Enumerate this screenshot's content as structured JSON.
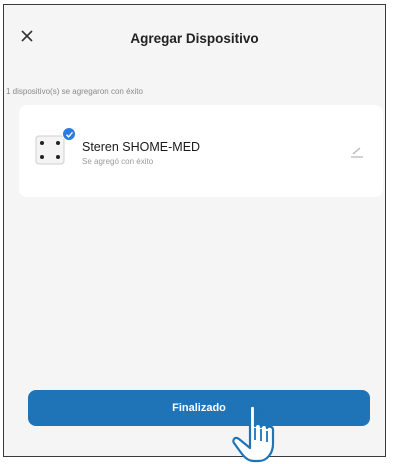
{
  "header": {
    "title": "Agregar Dispositivo"
  },
  "success_message": "1 dispositivo(s) se agregaron con éxito",
  "device": {
    "name": "Steren SHOME-MED",
    "status": "Se agregó con éxito"
  },
  "finish_button": {
    "label": "Finalizado"
  },
  "colors": {
    "accent": "#1f73b7",
    "badge": "#2c7be5"
  },
  "icons": [
    "close-icon",
    "device-icon",
    "check-icon",
    "edit-icon",
    "hand-pointer-icon"
  ]
}
